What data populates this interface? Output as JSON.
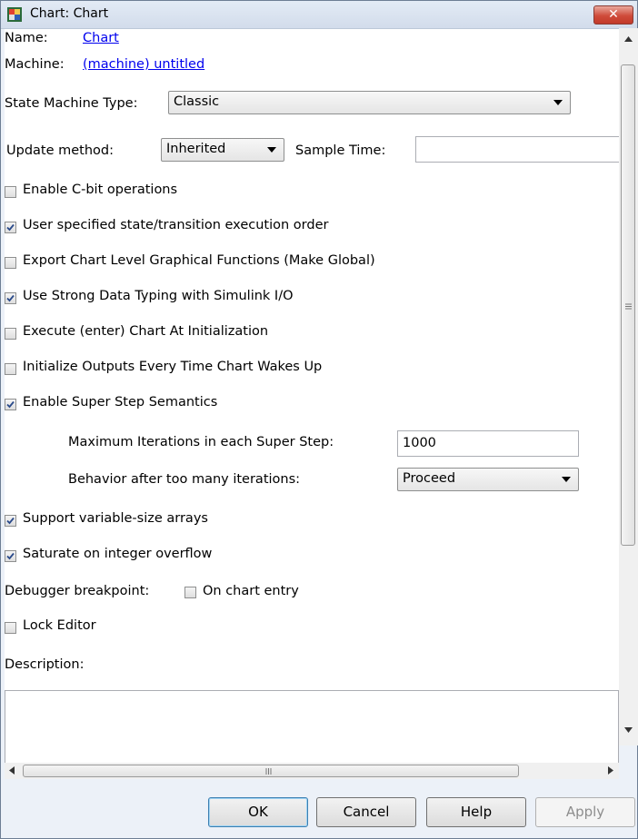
{
  "window": {
    "title": "Chart: Chart",
    "close_label": "✕"
  },
  "header": {
    "name_label": "Name:",
    "name_value": "Chart",
    "machine_label": "Machine:",
    "machine_value": "(machine) untitled"
  },
  "state_machine_type": {
    "label": "State Machine Type:",
    "value": "Classic"
  },
  "update_method": {
    "label": "Update method:",
    "value": "Inherited",
    "sample_time_label": "Sample Time:",
    "sample_time_value": ""
  },
  "options": [
    {
      "label": "Enable C-bit operations",
      "checked": false
    },
    {
      "label": "User specified state/transition execution order",
      "checked": true
    },
    {
      "label": "Export Chart Level Graphical Functions (Make Global)",
      "checked": false
    },
    {
      "label": "Use Strong Data Typing with Simulink I/O",
      "checked": true
    },
    {
      "label": "Execute (enter) Chart At Initialization",
      "checked": false
    },
    {
      "label": "Initialize Outputs Every Time Chart Wakes Up",
      "checked": false
    },
    {
      "label": "Enable Super Step Semantics",
      "checked": true
    }
  ],
  "super_step": {
    "max_iter_label": "Maximum Iterations in each Super Step:",
    "max_iter_value": "1000",
    "behavior_label": "Behavior after too many iterations:",
    "behavior_value": "Proceed"
  },
  "options2": [
    {
      "label": "Support variable-size arrays",
      "checked": true
    },
    {
      "label": "Saturate on integer overflow",
      "checked": true
    }
  ],
  "debugger": {
    "label": "Debugger breakpoint:",
    "option_label": "On chart entry",
    "checked": false
  },
  "lock_editor": {
    "label": "Lock Editor",
    "checked": false
  },
  "description": {
    "label": "Description:",
    "value": ""
  },
  "buttons": {
    "ok": "OK",
    "cancel": "Cancel",
    "help": "Help",
    "apply": "Apply"
  },
  "colors": {
    "link": "#0000ee",
    "title_bar": "#dbe4f0",
    "close": "#c94536",
    "check": "#2a4a8a"
  }
}
